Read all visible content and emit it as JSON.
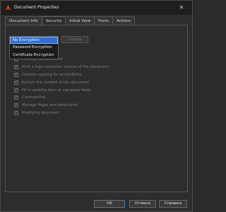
{
  "window": {
    "title": "Document Properties",
    "close_glyph": "✕",
    "icon": "pdf-app-icon",
    "accent_color": "#2f6fd6"
  },
  "tabs": [
    {
      "label": "Document Info"
    },
    {
      "label": "Security"
    },
    {
      "label": "Initial View"
    },
    {
      "label": "Fonts"
    },
    {
      "label": "Actions"
    }
  ],
  "security": {
    "settings_button": "Change",
    "dropdown": {
      "options": [
        "No Encryption",
        "Password Encryption",
        "Certificate Encryption"
      ],
      "selected": "No Encryption"
    },
    "permissions": [
      {
        "label": "Printing the document",
        "checked": true
      },
      {
        "label": "Print a high-resolution version of the document",
        "checked": true
      },
      {
        "label": "Content copying for accessibility",
        "checked": true
      },
      {
        "label": "Extract the content of the document",
        "checked": true
      },
      {
        "label": "Fill in existing form or signature fields",
        "checked": true
      },
      {
        "label": "Commenting",
        "checked": true
      },
      {
        "label": "Manage Pages and bookmarks",
        "checked": true
      },
      {
        "label": "Modifying document",
        "checked": true
      }
    ]
  },
  "footer": {
    "ok": "OK",
    "cancel": "Отмена",
    "help": "Справка"
  }
}
